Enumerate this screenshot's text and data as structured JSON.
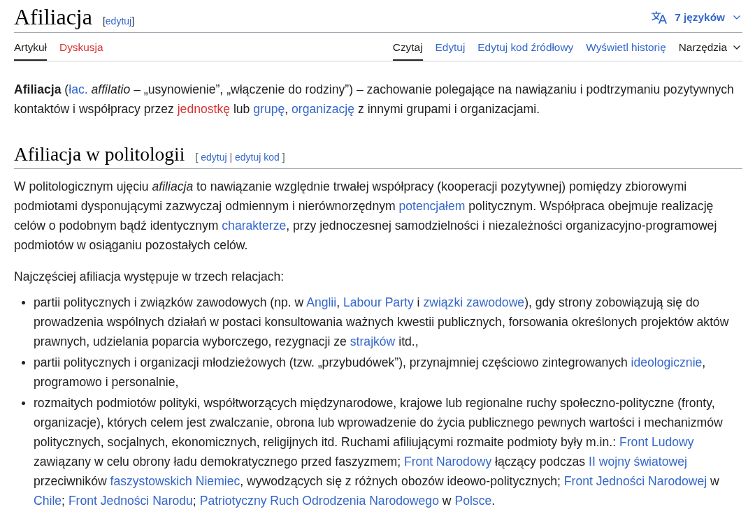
{
  "header": {
    "title": "Afiliacja",
    "edit_links": [
      {
        "kind": "text",
        "text": "["
      },
      {
        "kind": "link",
        "text": "edytuj"
      },
      {
        "kind": "text",
        "text": "]"
      }
    ],
    "languages": "7 języków"
  },
  "tabs_left": [
    {
      "label": "Artykuł",
      "selected": true,
      "exists": true
    },
    {
      "label": "Dyskusja",
      "selected": false,
      "exists": false
    }
  ],
  "tabs_right": [
    {
      "label": "Czytaj",
      "kind": "tab",
      "selected": true
    },
    {
      "label": "Edytuj",
      "kind": "tab",
      "selected": false
    },
    {
      "label": "Edytuj kod źródłowy",
      "kind": "tab",
      "selected": false
    },
    {
      "label": "Wyświetl historię",
      "kind": "tab",
      "selected": false
    },
    {
      "label": "Narzędzia",
      "kind": "menu",
      "selected": false
    }
  ],
  "intro": [
    {
      "kind": "text",
      "text": "**Afiliacja** ("
    },
    {
      "kind": "link",
      "text": "łac."
    },
    {
      "kind": "text",
      "text": " *affilatio* – „usynowienie”, „włączenie do rodziny”) – zachowanie polegające na nawiązaniu i podtrzymaniu pozytywnych kontaktów i współpracy przez "
    },
    {
      "kind": "redlink",
      "text": "jednostkę"
    },
    {
      "kind": "text",
      "text": " lub "
    },
    {
      "kind": "link",
      "text": "grupę"
    },
    {
      "kind": "text",
      "text": ", "
    },
    {
      "kind": "link",
      "text": "organizację"
    },
    {
      "kind": "text",
      "text": " z innymi grupami i organizacjami."
    }
  ],
  "sections": [
    {
      "heading": "Afiliacja w politologii",
      "edit_links": [
        {
          "kind": "text",
          "text": "[ "
        },
        {
          "kind": "link",
          "text": "edytuj"
        },
        {
          "kind": "text",
          "text": " | "
        },
        {
          "kind": "link",
          "text": "edytuj kod"
        },
        {
          "kind": "text",
          "text": " ]"
        }
      ],
      "blocks": [
        {
          "kind": "paragraph",
          "segments": [
            {
              "kind": "text",
              "text": "W politologicznym ujęciu *afiliacja* to nawiązanie względnie trwałej współpracy (kooperacji pozytywnej) pomiędzy zbiorowymi podmiotami dysponującymi zazwyczaj odmiennym i nierównorzędnym "
            },
            {
              "kind": "link",
              "text": "potencjałem"
            },
            {
              "kind": "text",
              "text": " politycznym. Współpraca obejmuje realizację celów o podobnym bądź identycznym "
            },
            {
              "kind": "link",
              "text": "charakterze"
            },
            {
              "kind": "text",
              "text": ", przy jednoczesnej samodzielności i niezależności organizacyjno-programowej podmiotów w osiąganiu pozostałych celów."
            }
          ]
        },
        {
          "kind": "paragraph",
          "segments": [
            {
              "kind": "text",
              "text": "Najczęściej afiliacja występuje w trzech relacjach:"
            }
          ]
        },
        {
          "kind": "list",
          "items": [
            [
              {
                "kind": "text",
                "text": "partii politycznych i związków zawodowych (np. w "
              },
              {
                "kind": "link",
                "text": "Anglii"
              },
              {
                "kind": "text",
                "text": ", "
              },
              {
                "kind": "link",
                "text": "Labour Party"
              },
              {
                "kind": "text",
                "text": " i "
              },
              {
                "kind": "link",
                "text": "związki zawodowe"
              },
              {
                "kind": "text",
                "text": "), gdy strony zobowiązują się do prowadzenia wspólnych działań w postaci konsultowania ważnych kwestii publicznych, forsowania określonych projektów aktów prawnych, udzielania poparcia wyborczego, rezygnacji ze "
              },
              {
                "kind": "link",
                "text": "strajków"
              },
              {
                "kind": "text",
                "text": " itd.,"
              }
            ],
            [
              {
                "kind": "text",
                "text": "partii politycznych i organizacji młodzieżowych (tzw. „przybudówek”), przynajmniej częściowo zintegrowanych "
              },
              {
                "kind": "link",
                "text": "ideologicznie"
              },
              {
                "kind": "text",
                "text": ", programowo i personalnie,"
              }
            ],
            [
              {
                "kind": "text",
                "text": "rozmaitych podmiotów polityki, współtworzących międzynarodowe, krajowe lub regionalne ruchy społeczno-polityczne (fronty, organizacje), których celem jest zwalczanie, obrona lub wprowadzenie do życia publicznego pewnych wartości i mechanizmów politycznych, socjalnych, ekonomicznych, religijnych itd. Ruchami afiliującymi rozmaite podmioty były m.in.: "
              },
              {
                "kind": "link",
                "text": "Front Ludowy"
              },
              {
                "kind": "text",
                "text": " zawiązany w celu obrony ładu demokratycznego przed faszyzmem; "
              },
              {
                "kind": "link",
                "text": "Front Narodowy"
              },
              {
                "kind": "text",
                "text": " łączący podczas "
              },
              {
                "kind": "link",
                "text": "II wojny światowej"
              },
              {
                "kind": "text",
                "text": " przeciwników "
              },
              {
                "kind": "link",
                "text": "faszystowskich Niemiec"
              },
              {
                "kind": "text",
                "text": ", wywodzących się z różnych obozów ideowo-politycznych; "
              },
              {
                "kind": "link",
                "text": "Front Jedności Narodowej"
              },
              {
                "kind": "text",
                "text": " w "
              },
              {
                "kind": "link",
                "text": "Chile"
              },
              {
                "kind": "text",
                "text": "; "
              },
              {
                "kind": "link",
                "text": "Front Jedności Narodu"
              },
              {
                "kind": "text",
                "text": "; "
              },
              {
                "kind": "link",
                "text": "Patriotyczny Ruch Odrodzenia Narodowego"
              },
              {
                "kind": "text",
                "text": " w "
              },
              {
                "kind": "link",
                "text": "Polsce"
              },
              {
                "kind": "text",
                "text": "."
              }
            ]
          ]
        }
      ]
    }
  ]
}
